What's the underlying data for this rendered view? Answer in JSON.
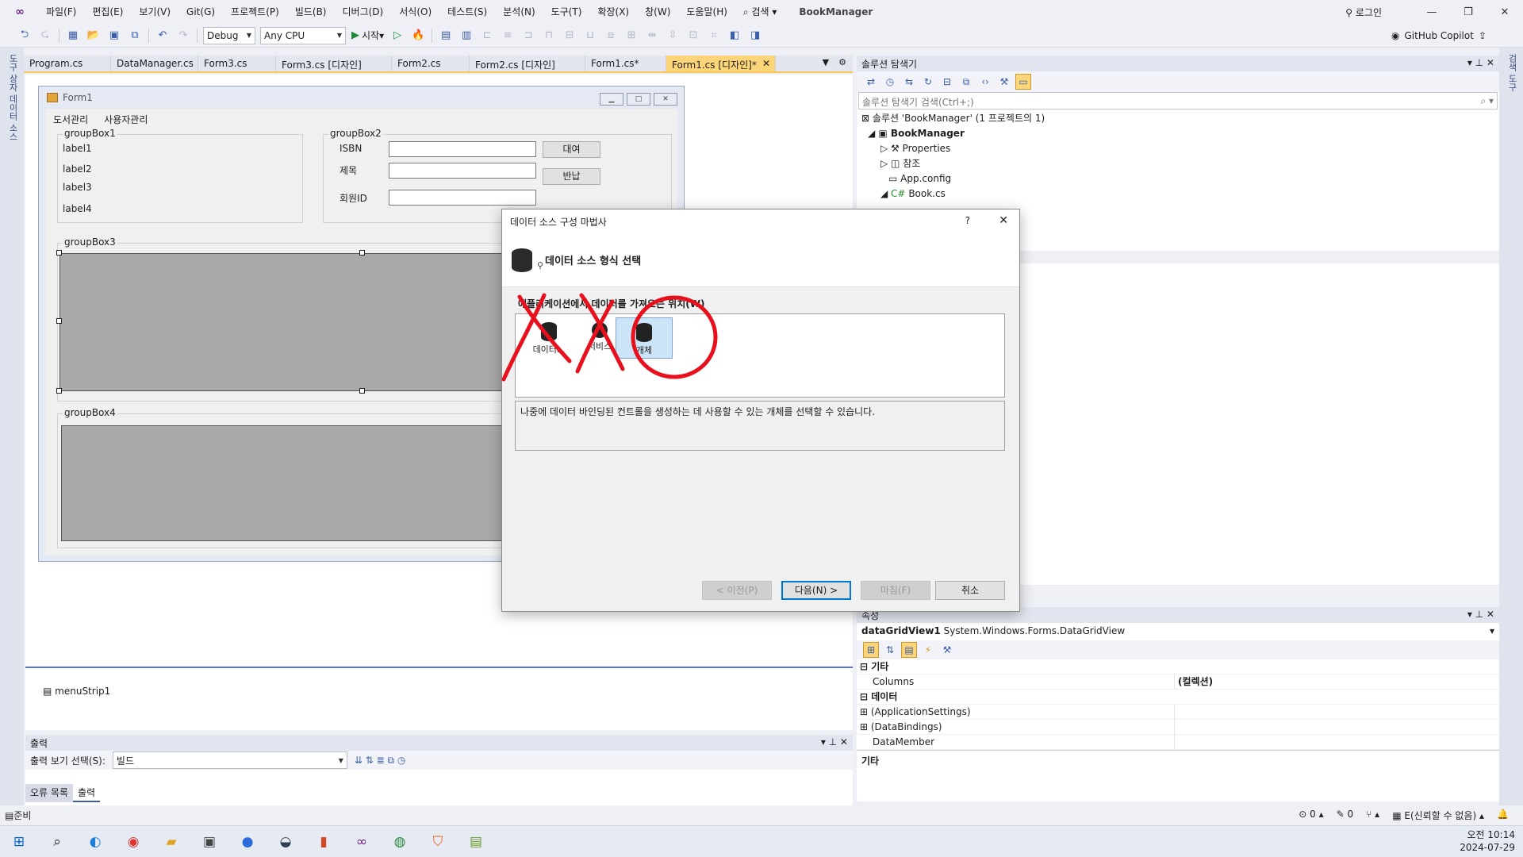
{
  "menubar": {
    "items": [
      "파일(F)",
      "편집(E)",
      "보기(V)",
      "Git(G)",
      "프로젝트(P)",
      "빌드(B)",
      "디버그(D)",
      "서식(O)",
      "테스트(S)",
      "분석(N)",
      "도구(T)",
      "확장(X)",
      "창(W)",
      "도움말(H)"
    ],
    "search_label": "검색",
    "solution_name": "BookManager",
    "login_label": "로그인"
  },
  "toolbar": {
    "config": "Debug",
    "platform": "Any CPU",
    "start_label": "시작",
    "copilot_label": "GitHub Copilot"
  },
  "side_strips": {
    "left": "도구 상자  데이터 소스",
    "right": "검색 도구"
  },
  "doc_tabs": [
    "Program.cs",
    "DataManager.cs",
    "Form3.cs",
    "Form3.cs [디자인]",
    "Form2.cs",
    "Form2.cs [디자인]",
    "Form1.cs*",
    "Form1.cs [디자인]*"
  ],
  "form": {
    "title": "Form1",
    "menu": [
      "도서관리",
      "사용자관리"
    ],
    "groupbox1": {
      "caption": "groupBox1",
      "labels": [
        "label1",
        "label2",
        "label3",
        "label4"
      ]
    },
    "groupbox2": {
      "caption": "groupBox2",
      "labels": [
        "ISBN",
        "제목",
        "회원ID"
      ],
      "buttons": [
        "대여",
        "반납"
      ]
    },
    "groupbox3": "groupBox3",
    "groupbox4": "groupBox4"
  },
  "tray": {
    "component": "menuStrip1"
  },
  "output": {
    "title": "출력",
    "show_label": "출력 보기 선택(S):",
    "show_value": "빌드",
    "tabs": [
      "오류 목록",
      "출력"
    ]
  },
  "solution_explorer": {
    "title": "솔루션 탐색기",
    "search_placeholder": "솔루션 탐색기 검색(Ctrl+;)",
    "rows": [
      "솔루션 'BookManager' (1 프로젝트의 1)",
      "BookManager",
      "Properties",
      "참조",
      "App.config",
      "Book.cs"
    ]
  },
  "properties": {
    "title": "속성",
    "object_name": "dataGridView1",
    "object_type": "System.Windows.Forms.DataGridView",
    "category": "기타",
    "rows": [
      {
        "name": "Columns",
        "value": "(컬렉션)"
      }
    ],
    "category2": "데이터",
    "rows2": [
      "(ApplicationSettings)",
      "(DataBindings)",
      "DataMember"
    ],
    "footer": "기타"
  },
  "dialog": {
    "title": "데이터 소스 구성 마법사",
    "help": "?",
    "header": "데이터 소스 형식 선택",
    "prompt": "애플리케이션에서 데이터를 가져오는 위치(W)",
    "choices": [
      {
        "label": "데이터..."
      },
      {
        "label": "서비스"
      },
      {
        "label": "개체"
      }
    ],
    "description": "나중에 데이터 바인딩된 컨트롤을 생성하는 데 사용할 수 있는 개체를 선택할 수 있습니다.",
    "buttons": {
      "prev": "< 이전(P)",
      "next": "다음(N) >",
      "finish": "마침(F)",
      "cancel": "취소"
    }
  },
  "statusbar": {
    "ready": "준비",
    "errors": "0",
    "edits": "0",
    "source_control": "E(신뢰할 수 없음)"
  },
  "clock": {
    "time": "오전 10:14",
    "date": "2024-07-29"
  },
  "annotation_color": "#e8101c"
}
